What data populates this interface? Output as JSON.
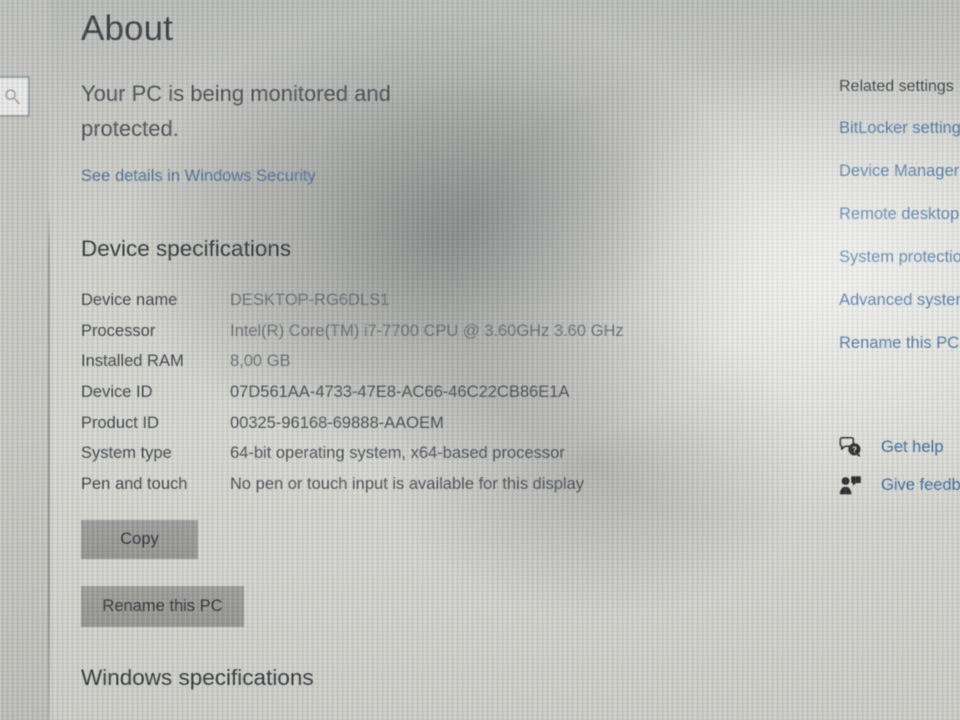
{
  "window": {
    "page_title": "About"
  },
  "nav": {
    "search_icon": "search-icon"
  },
  "status": {
    "message": "Your PC is being monitored and protected.",
    "link_label": "See details in Windows Security"
  },
  "device_specifications": {
    "heading": "Device specifications",
    "rows": [
      {
        "label": "Device name",
        "value": "DESKTOP-RG6DLS1"
      },
      {
        "label": "Processor",
        "value": "Intel(R) Core(TM) i7-7700 CPU @ 3.60GHz   3.60 GHz"
      },
      {
        "label": "Installed RAM",
        "value": "8,00 GB"
      },
      {
        "label": "Device ID",
        "value": "07D561AA-4733-47E8-AC66-46C22CB86E1A"
      },
      {
        "label": "Product ID",
        "value": "00325-96168-69888-AAOEM"
      },
      {
        "label": "System type",
        "value": "64-bit operating system, x64-based processor"
      },
      {
        "label": "Pen and touch",
        "value": "No pen or touch input is available for this display"
      }
    ],
    "copy_label": "Copy",
    "rename_label": "Rename this PC"
  },
  "windows_specifications": {
    "heading": "Windows specifications"
  },
  "related_settings": {
    "heading": "Related settings",
    "links": [
      "BitLocker settings",
      "Device Manager",
      "Remote desktop",
      "System protection",
      "Advanced system settings",
      "Rename this PC"
    ]
  },
  "support": {
    "items": [
      {
        "label": "Get help",
        "icon": "help-bubble-icon"
      },
      {
        "label": "Give feedback",
        "icon": "feedback-person-icon"
      }
    ]
  },
  "colors": {
    "link_blue": "#3f6d9e",
    "security_link_blue": "#4f7396",
    "heading_gray": "#33383c",
    "label_gray": "#3f464b",
    "value_gray": "#4a5156",
    "button_gray": "#8f908c",
    "screen_bg": "#d3d3ce"
  }
}
